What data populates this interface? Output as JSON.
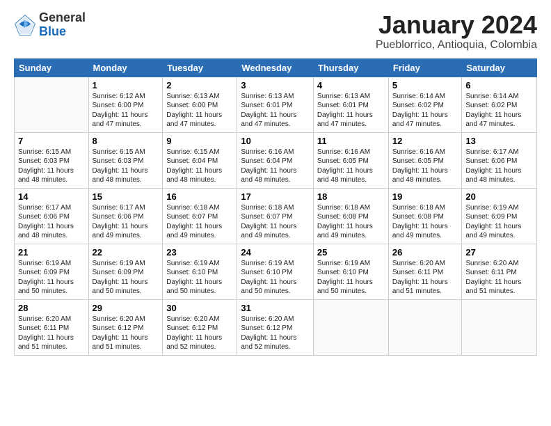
{
  "logo": {
    "general": "General",
    "blue": "Blue"
  },
  "title": "January 2024",
  "subtitle": "Pueblorrico, Antioquia, Colombia",
  "headers": [
    "Sunday",
    "Monday",
    "Tuesday",
    "Wednesday",
    "Thursday",
    "Friday",
    "Saturday"
  ],
  "weeks": [
    [
      {
        "date": "",
        "sunrise": "",
        "sunset": "",
        "daylight": ""
      },
      {
        "date": "1",
        "sunrise": "Sunrise: 6:12 AM",
        "sunset": "Sunset: 6:00 PM",
        "daylight": "Daylight: 11 hours and 47 minutes."
      },
      {
        "date": "2",
        "sunrise": "Sunrise: 6:13 AM",
        "sunset": "Sunset: 6:00 PM",
        "daylight": "Daylight: 11 hours and 47 minutes."
      },
      {
        "date": "3",
        "sunrise": "Sunrise: 6:13 AM",
        "sunset": "Sunset: 6:01 PM",
        "daylight": "Daylight: 11 hours and 47 minutes."
      },
      {
        "date": "4",
        "sunrise": "Sunrise: 6:13 AM",
        "sunset": "Sunset: 6:01 PM",
        "daylight": "Daylight: 11 hours and 47 minutes."
      },
      {
        "date": "5",
        "sunrise": "Sunrise: 6:14 AM",
        "sunset": "Sunset: 6:02 PM",
        "daylight": "Daylight: 11 hours and 47 minutes."
      },
      {
        "date": "6",
        "sunrise": "Sunrise: 6:14 AM",
        "sunset": "Sunset: 6:02 PM",
        "daylight": "Daylight: 11 hours and 47 minutes."
      }
    ],
    [
      {
        "date": "7",
        "sunrise": "Sunrise: 6:15 AM",
        "sunset": "Sunset: 6:03 PM",
        "daylight": "Daylight: 11 hours and 48 minutes."
      },
      {
        "date": "8",
        "sunrise": "Sunrise: 6:15 AM",
        "sunset": "Sunset: 6:03 PM",
        "daylight": "Daylight: 11 hours and 48 minutes."
      },
      {
        "date": "9",
        "sunrise": "Sunrise: 6:15 AM",
        "sunset": "Sunset: 6:04 PM",
        "daylight": "Daylight: 11 hours and 48 minutes."
      },
      {
        "date": "10",
        "sunrise": "Sunrise: 6:16 AM",
        "sunset": "Sunset: 6:04 PM",
        "daylight": "Daylight: 11 hours and 48 minutes."
      },
      {
        "date": "11",
        "sunrise": "Sunrise: 6:16 AM",
        "sunset": "Sunset: 6:05 PM",
        "daylight": "Daylight: 11 hours and 48 minutes."
      },
      {
        "date": "12",
        "sunrise": "Sunrise: 6:16 AM",
        "sunset": "Sunset: 6:05 PM",
        "daylight": "Daylight: 11 hours and 48 minutes."
      },
      {
        "date": "13",
        "sunrise": "Sunrise: 6:17 AM",
        "sunset": "Sunset: 6:06 PM",
        "daylight": "Daylight: 11 hours and 48 minutes."
      }
    ],
    [
      {
        "date": "14",
        "sunrise": "Sunrise: 6:17 AM",
        "sunset": "Sunset: 6:06 PM",
        "daylight": "Daylight: 11 hours and 48 minutes."
      },
      {
        "date": "15",
        "sunrise": "Sunrise: 6:17 AM",
        "sunset": "Sunset: 6:06 PM",
        "daylight": "Daylight: 11 hours and 49 minutes."
      },
      {
        "date": "16",
        "sunrise": "Sunrise: 6:18 AM",
        "sunset": "Sunset: 6:07 PM",
        "daylight": "Daylight: 11 hours and 49 minutes."
      },
      {
        "date": "17",
        "sunrise": "Sunrise: 6:18 AM",
        "sunset": "Sunset: 6:07 PM",
        "daylight": "Daylight: 11 hours and 49 minutes."
      },
      {
        "date": "18",
        "sunrise": "Sunrise: 6:18 AM",
        "sunset": "Sunset: 6:08 PM",
        "daylight": "Daylight: 11 hours and 49 minutes."
      },
      {
        "date": "19",
        "sunrise": "Sunrise: 6:18 AM",
        "sunset": "Sunset: 6:08 PM",
        "daylight": "Daylight: 11 hours and 49 minutes."
      },
      {
        "date": "20",
        "sunrise": "Sunrise: 6:19 AM",
        "sunset": "Sunset: 6:09 PM",
        "daylight": "Daylight: 11 hours and 49 minutes."
      }
    ],
    [
      {
        "date": "21",
        "sunrise": "Sunrise: 6:19 AM",
        "sunset": "Sunset: 6:09 PM",
        "daylight": "Daylight: 11 hours and 50 minutes."
      },
      {
        "date": "22",
        "sunrise": "Sunrise: 6:19 AM",
        "sunset": "Sunset: 6:09 PM",
        "daylight": "Daylight: 11 hours and 50 minutes."
      },
      {
        "date": "23",
        "sunrise": "Sunrise: 6:19 AM",
        "sunset": "Sunset: 6:10 PM",
        "daylight": "Daylight: 11 hours and 50 minutes."
      },
      {
        "date": "24",
        "sunrise": "Sunrise: 6:19 AM",
        "sunset": "Sunset: 6:10 PM",
        "daylight": "Daylight: 11 hours and 50 minutes."
      },
      {
        "date": "25",
        "sunrise": "Sunrise: 6:19 AM",
        "sunset": "Sunset: 6:10 PM",
        "daylight": "Daylight: 11 hours and 50 minutes."
      },
      {
        "date": "26",
        "sunrise": "Sunrise: 6:20 AM",
        "sunset": "Sunset: 6:11 PM",
        "daylight": "Daylight: 11 hours and 51 minutes."
      },
      {
        "date": "27",
        "sunrise": "Sunrise: 6:20 AM",
        "sunset": "Sunset: 6:11 PM",
        "daylight": "Daylight: 11 hours and 51 minutes."
      }
    ],
    [
      {
        "date": "28",
        "sunrise": "Sunrise: 6:20 AM",
        "sunset": "Sunset: 6:11 PM",
        "daylight": "Daylight: 11 hours and 51 minutes."
      },
      {
        "date": "29",
        "sunrise": "Sunrise: 6:20 AM",
        "sunset": "Sunset: 6:12 PM",
        "daylight": "Daylight: 11 hours and 51 minutes."
      },
      {
        "date": "30",
        "sunrise": "Sunrise: 6:20 AM",
        "sunset": "Sunset: 6:12 PM",
        "daylight": "Daylight: 11 hours and 52 minutes."
      },
      {
        "date": "31",
        "sunrise": "Sunrise: 6:20 AM",
        "sunset": "Sunset: 6:12 PM",
        "daylight": "Daylight: 11 hours and 52 minutes."
      },
      {
        "date": "",
        "sunrise": "",
        "sunset": "",
        "daylight": ""
      },
      {
        "date": "",
        "sunrise": "",
        "sunset": "",
        "daylight": ""
      },
      {
        "date": "",
        "sunrise": "",
        "sunset": "",
        "daylight": ""
      }
    ]
  ]
}
